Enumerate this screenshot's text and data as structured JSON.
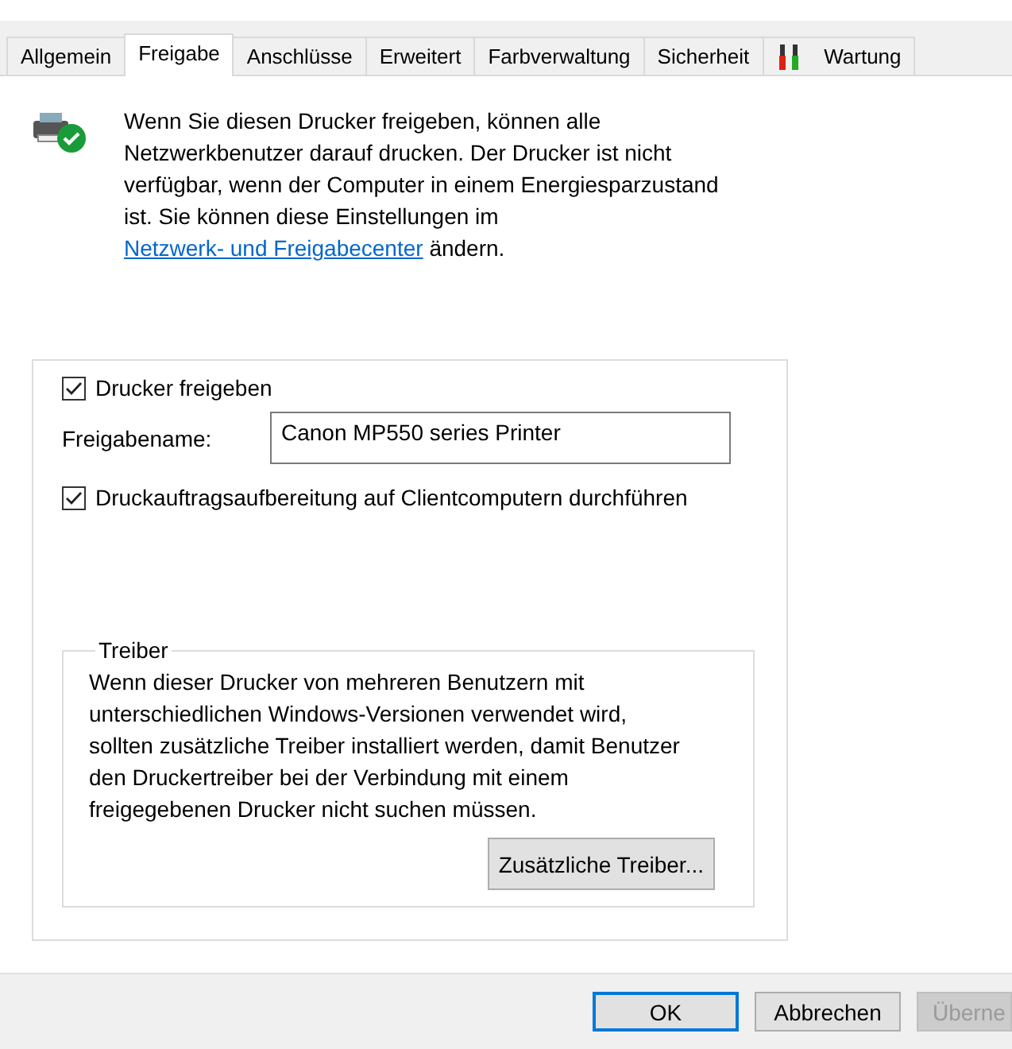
{
  "tabs": [
    {
      "label": "Allgemein",
      "selected": false
    },
    {
      "label": "Freigabe",
      "selected": true
    },
    {
      "label": "Anschlüsse",
      "selected": false
    },
    {
      "label": "Erweitert",
      "selected": false
    },
    {
      "label": "Farbverwaltung",
      "selected": false
    },
    {
      "label": "Sicherheit",
      "selected": false
    },
    {
      "label": "Wartung",
      "selected": false,
      "kind": "with_icon"
    }
  ],
  "intro": {
    "text_before": "Wenn Sie diesen Drucker freigeben, können alle Netzwerkbenutzer darauf drucken. Der Drucker ist nicht verfügbar, wenn der Computer in einem Energiesparzustand ist. Sie können diese Einstellungen im",
    "link": "Netzwerk- und Freigabecenter",
    "text_after": "ändern."
  },
  "share_checkbox": {
    "label": "Drucker freigeben",
    "checked": true
  },
  "share_name": {
    "label": "Freigabename:",
    "value": "Canon MP550 series Printer"
  },
  "render_checkbox": {
    "label": "Druckauftragsaufbereitung auf Clientcomputern durchführen",
    "checked": true
  },
  "drivers": {
    "title": "Treiber",
    "text": "Wenn dieser Drucker von mehreren Benutzern mit unterschiedlichen Windows-Versionen verwendet wird, sollten zusätzliche Treiber installiert werden, damit Benutzer den Druckertreiber bei der Verbindung mit einem freigegebenen Drucker nicht suchen müssen.",
    "button": "Zusätzliche Treiber..."
  },
  "buttons": [
    {
      "label": "OK",
      "kind": "default",
      "disabled": false
    },
    {
      "label": "Abbrechen",
      "kind": "normal",
      "disabled": false
    },
    {
      "label": "Überne",
      "kind": "normal",
      "disabled": true
    }
  ]
}
